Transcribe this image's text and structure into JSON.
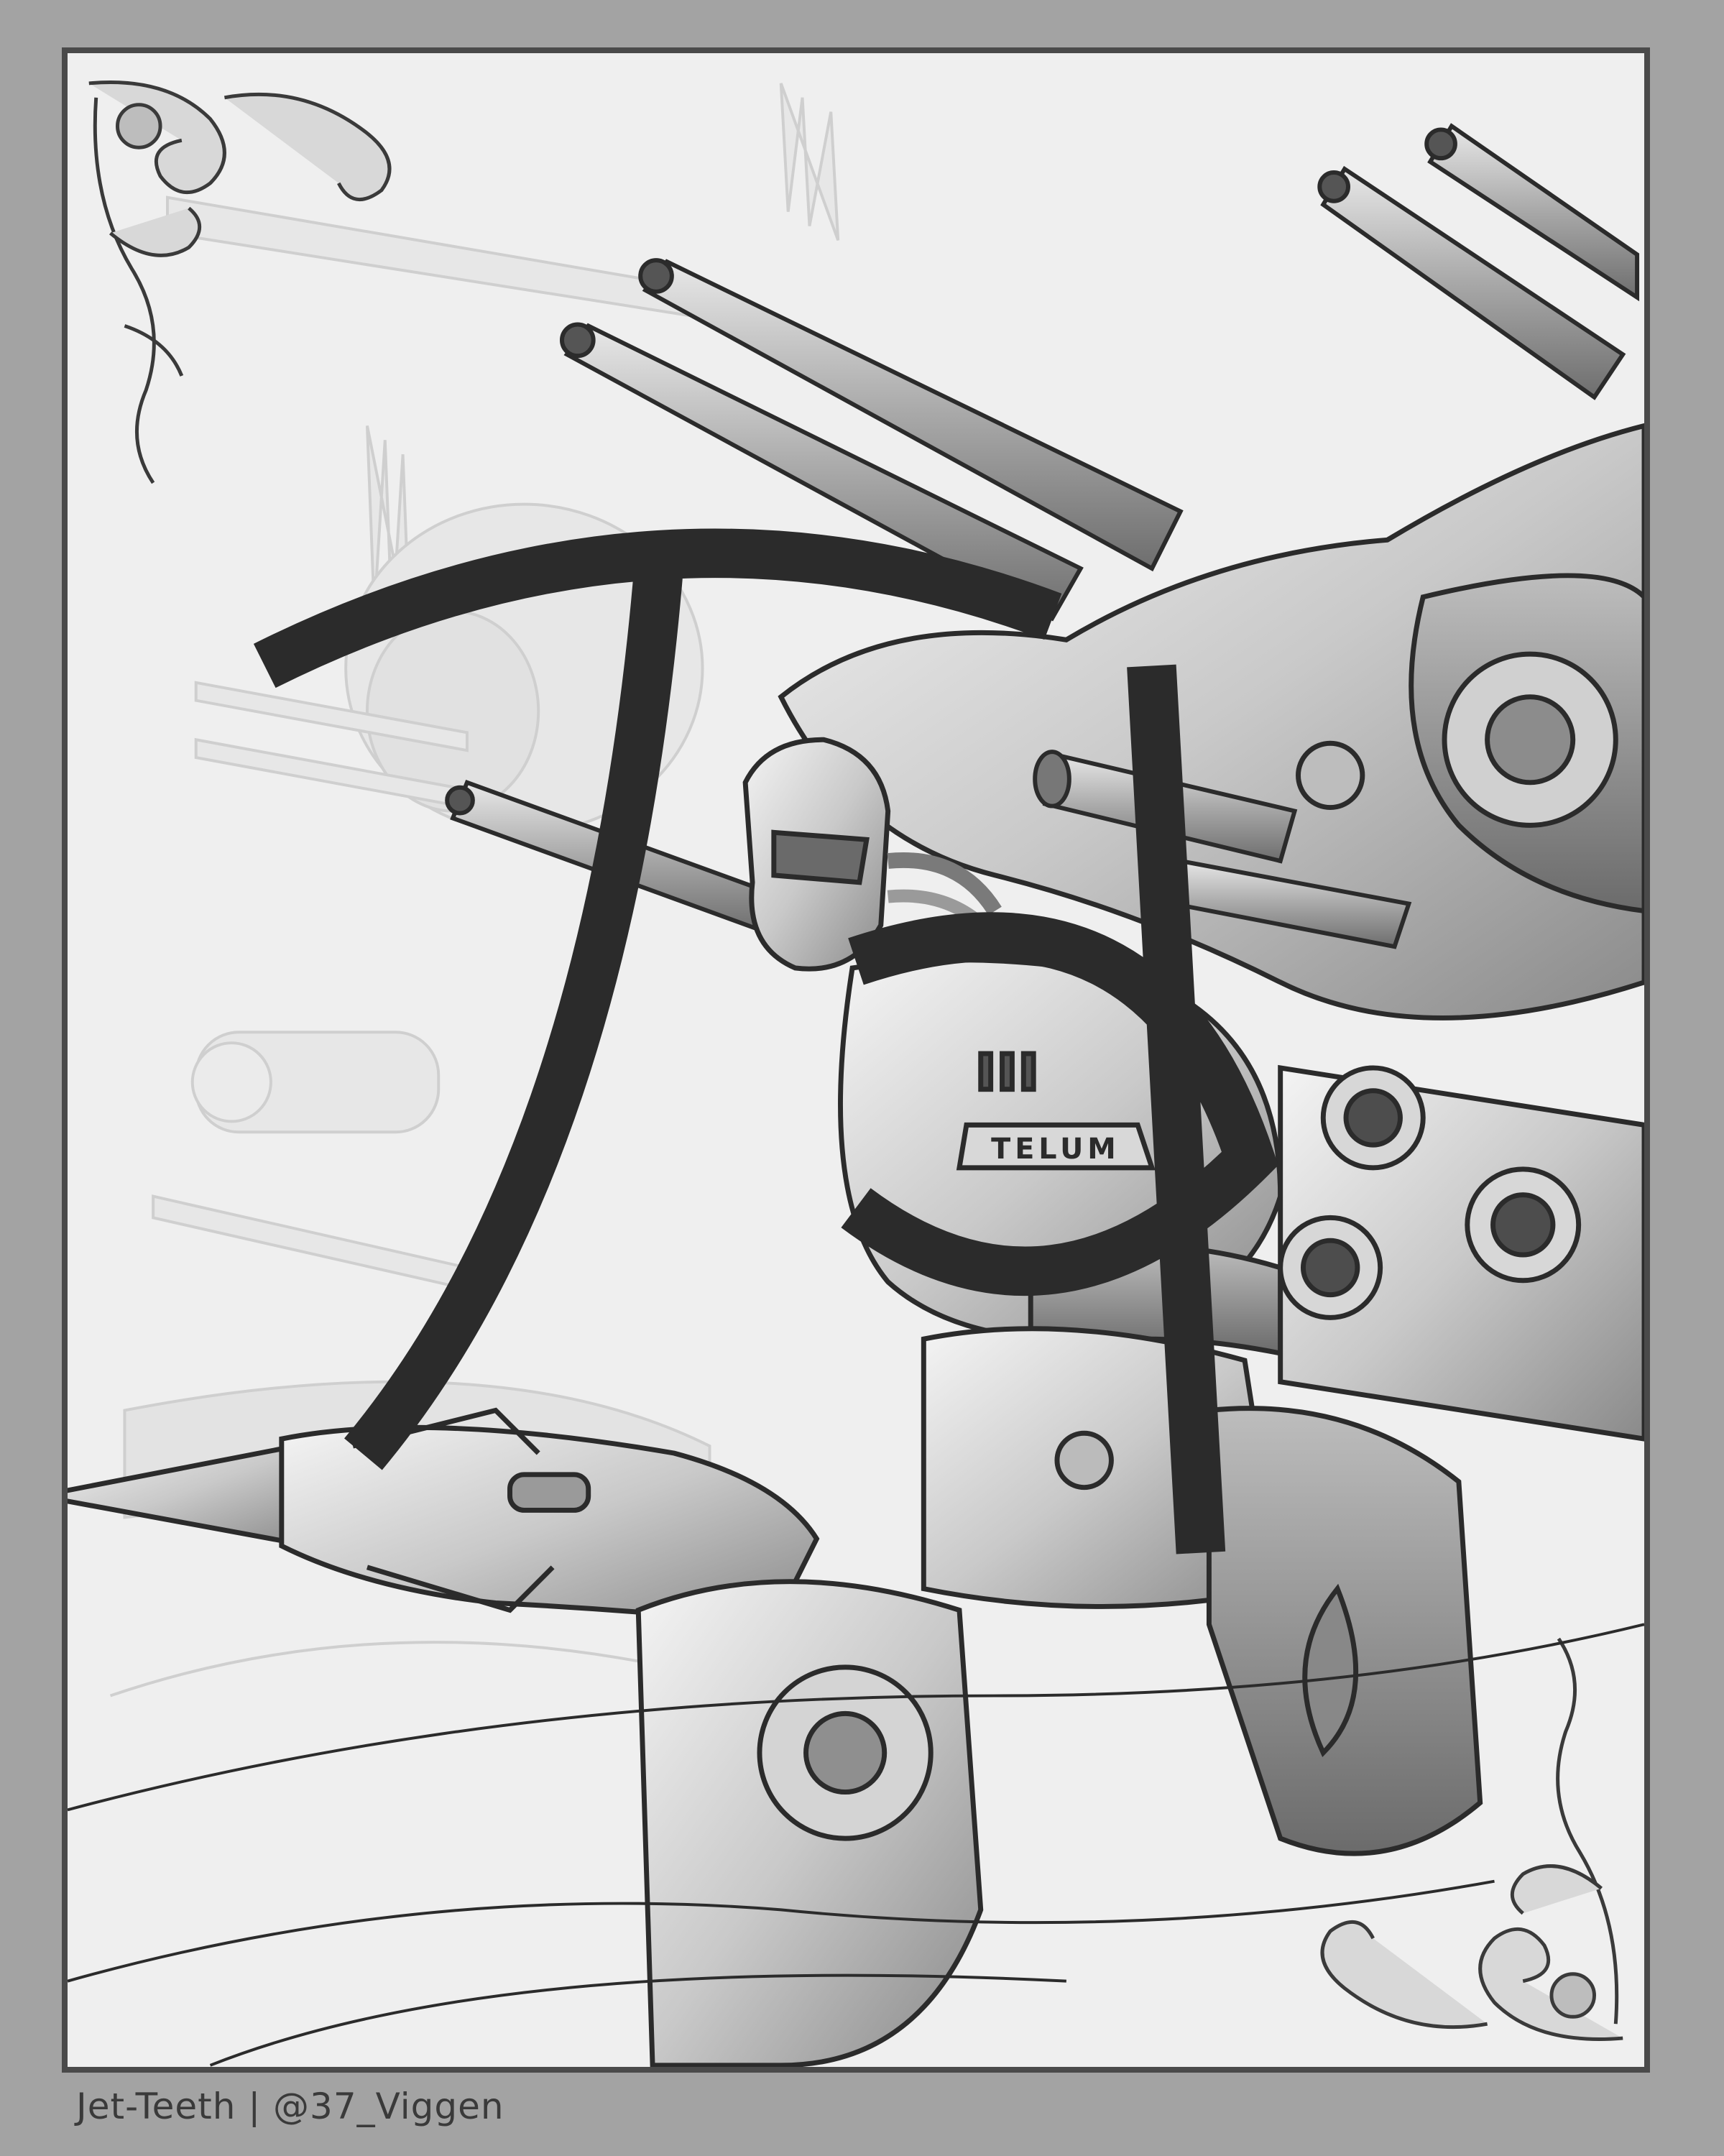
{
  "artwork": {
    "description_hidden": "",
    "plate_text": "TELUM",
    "credit": "Jet-Teeth | @37_Viggen"
  },
  "colors": {
    "background": "#a3a3a3",
    "paper": "#efefef",
    "ink": "#2b2b2b",
    "ghost": "#cfcfcf",
    "frame": "#4a4a4a"
  }
}
